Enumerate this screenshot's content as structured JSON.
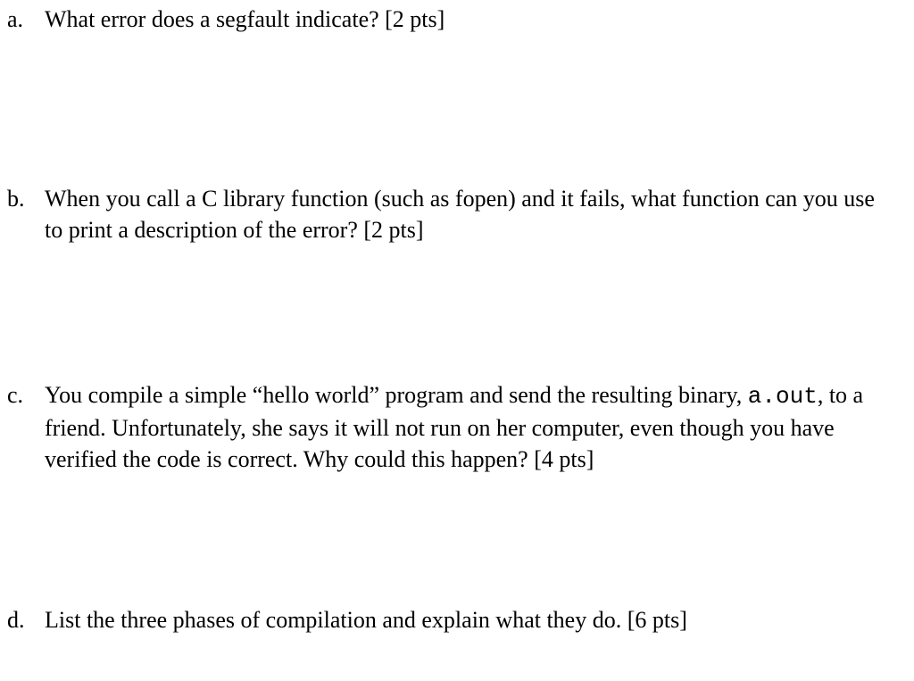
{
  "questions": {
    "a": {
      "marker": "a.",
      "text": "What error does a segfault indicate? [2 pts]"
    },
    "b": {
      "marker": "b.",
      "text": "When you call a C library function (such as fopen) and it fails, what function can you use to print a description of the error? [2 pts]"
    },
    "c": {
      "marker": "c.",
      "text_part1": "You compile a simple “hello world” program and send the resulting binary, ",
      "code": "a.out",
      "text_part2": ", to a friend. Unfortunately, she says it will not run on her computer, even though you have verified the code is correct. Why could this happen? [4 pts]"
    },
    "d": {
      "marker": "d.",
      "text": "List the three phases of compilation and explain what they do. [6 pts]"
    }
  }
}
